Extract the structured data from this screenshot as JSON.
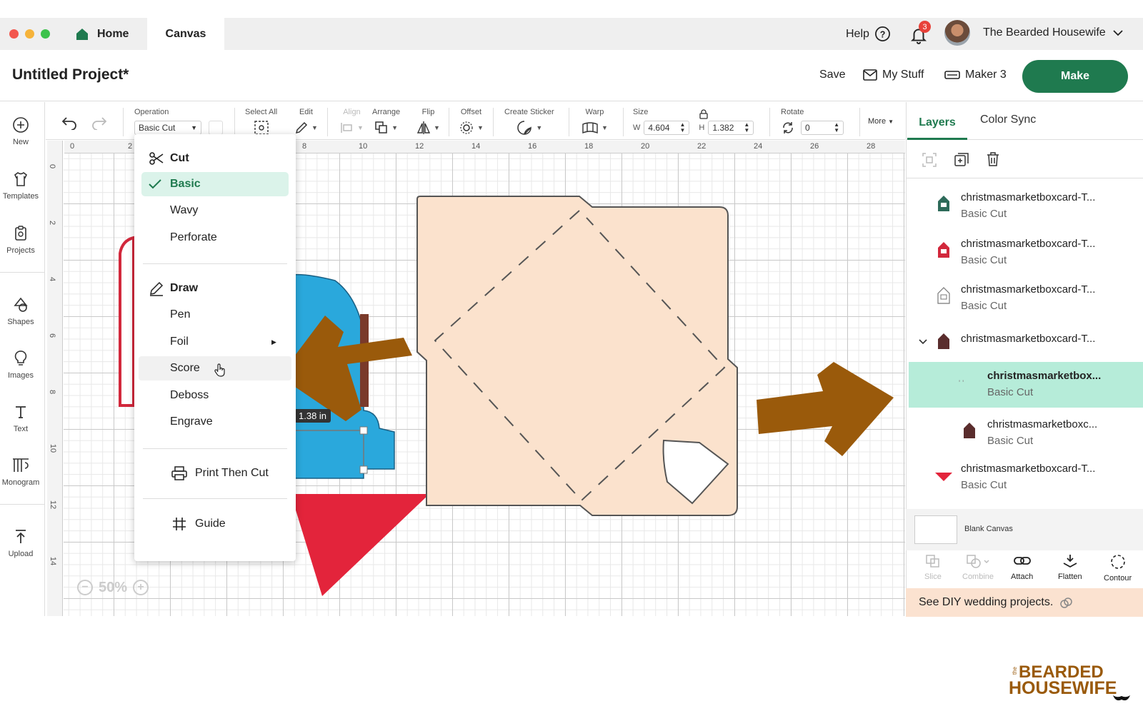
{
  "titlebar": {
    "tabs": [
      {
        "label": "Home"
      },
      {
        "label": "Canvas"
      }
    ],
    "help_label": "Help",
    "notification_count": "3",
    "user_name": "The Bearded Housewife"
  },
  "header": {
    "project_title": "Untitled Project*",
    "save_label": "Save",
    "mystuff_label": "My Stuff",
    "machine_label": "Maker 3",
    "make_label": "Make"
  },
  "leftnav": {
    "items": [
      {
        "label": "New",
        "icon": "plus-circle-icon"
      },
      {
        "label": "Templates",
        "icon": "shirt-icon"
      },
      {
        "label": "Projects",
        "icon": "clipboard-icon"
      },
      {
        "label": "Shapes",
        "icon": "shapes-icon"
      },
      {
        "label": "Images",
        "icon": "lightbulb-icon"
      },
      {
        "label": "Text",
        "icon": "text-icon"
      },
      {
        "label": "Monogram",
        "icon": "monogram-icon"
      },
      {
        "label": "Upload",
        "icon": "upload-icon"
      }
    ]
  },
  "toolbar": {
    "operation_label": "Operation",
    "operation_value": "Basic Cut",
    "select_all_label": "Select All",
    "edit_label": "Edit",
    "align_label": "Align",
    "arrange_label": "Arrange",
    "flip_label": "Flip",
    "offset_label": "Offset",
    "create_sticker_label": "Create Sticker",
    "warp_label": "Warp",
    "size_label": "Size",
    "width_prefix": "W",
    "width_value": "4.604",
    "height_prefix": "H",
    "height_value": "1.382",
    "rotate_label": "Rotate",
    "rotate_value": "0",
    "more_label": "More"
  },
  "ruler": {
    "top_ticks": [
      "0",
      "2",
      "8",
      "10",
      "12",
      "14",
      "16",
      "18",
      "20",
      "22",
      "24",
      "26",
      "28"
    ],
    "left_ticks": [
      "0",
      "2",
      "4",
      "6",
      "8",
      "10",
      "12",
      "14"
    ]
  },
  "operation_menu": {
    "cut_header": "Cut",
    "cut_items": [
      "Basic",
      "Wavy",
      "Perforate"
    ],
    "selected": "Basic",
    "draw_header": "Draw",
    "draw_items": [
      "Pen",
      "Foil",
      "Score",
      "Deboss",
      "Engrave"
    ],
    "print_then_cut": "Print Then Cut",
    "guide": "Guide"
  },
  "canvas": {
    "dimension_tooltip": "1.38 in",
    "zoom": "50%"
  },
  "layers_panel": {
    "tabs": [
      "Layers",
      "Color Sync"
    ],
    "layers": [
      {
        "name": "christmasmarketboxcard-T...",
        "op": "Basic Cut",
        "color": "#2e6b5a"
      },
      {
        "name": "christmasmarketboxcard-T...",
        "op": "Basic Cut",
        "color": "#d2283c"
      },
      {
        "name": "christmasmarketboxcard-T...",
        "op": "Basic Cut",
        "color": "#ffffff"
      },
      {
        "name": "christmasmarketboxcard-T...",
        "op": "",
        "color": "#5a2d2d"
      },
      {
        "name": "christmasmarketbox...",
        "op": "Basic Cut",
        "color": "#fbe2cd",
        "selected": true
      },
      {
        "name": "christmasmarketboxc...",
        "op": "Basic Cut",
        "color": "#5a2d2d"
      },
      {
        "name": "christmasmarketboxcard-T...",
        "op": "Basic Cut",
        "color": "#e3243b"
      }
    ],
    "blank_canvas_label": "Blank Canvas",
    "bottom_tools": [
      "Slice",
      "Combine",
      "Attach",
      "Flatten",
      "Contour"
    ]
  },
  "promo": {
    "text": "See DIY wedding projects."
  },
  "logo": {
    "line1": "BEARDED",
    "line2": "HOUSEWIFE",
    "small": "the"
  },
  "colors": {
    "brand_green": "#1f7a4f",
    "selected_layer": "#b6ecd9",
    "arrow": "#9a5a0b",
    "card": "#fbe2cd",
    "blue_shape": "#2aa8dc",
    "red_shape": "#e3243b"
  }
}
